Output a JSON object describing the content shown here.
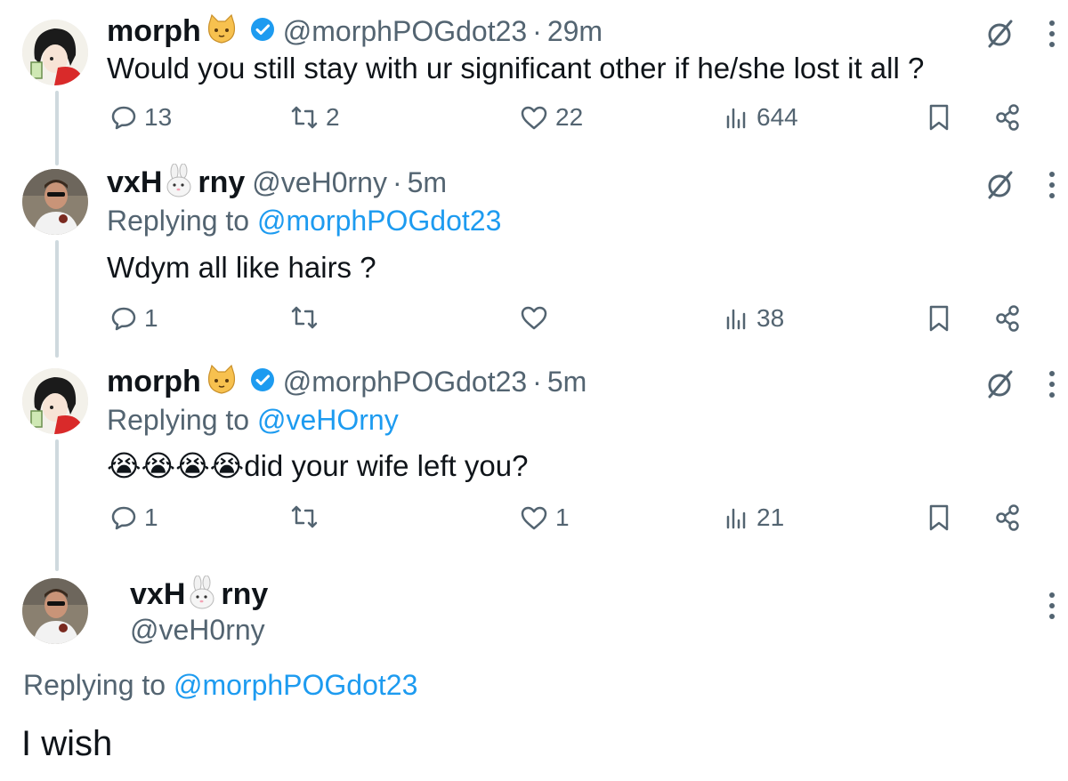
{
  "tweets": [
    {
      "name": "morph",
      "handle": "@morphPOGdot23",
      "time": "29m",
      "reply_prefix": "",
      "reply_to": "",
      "text": "Would you still stay with ur significant other if he/she lost it all ?",
      "replies": "13",
      "retweets": "2",
      "likes": "22",
      "views": "644"
    },
    {
      "name_a": "vxH",
      "name_b": "rny",
      "handle": "@veH0rny",
      "time": "5m",
      "reply_prefix": "Replying to",
      "reply_to": "@morphPOGdot23",
      "text": "Wdym all like hairs ?",
      "replies": "1",
      "retweets": "",
      "likes": "",
      "views": "38"
    },
    {
      "name": "morph",
      "handle": "@morphPOGdot23",
      "time": "5m",
      "reply_prefix": "Replying to",
      "reply_to": "@veHOrny",
      "emoji_prefix": "😭😭😭😭",
      "text": "did your wife left you?",
      "replies": "1",
      "retweets": "",
      "likes": "1",
      "views": "21"
    }
  ],
  "focused": {
    "name_a": "vxH",
    "name_b": "rny",
    "handle": "@veH0rny",
    "reply_prefix": "Replying to",
    "reply_to": "@morphPOGdot23",
    "text": "I wish"
  },
  "icons": {
    "verified": "verified-badge-icon",
    "cat": "cat-emoji-icon",
    "rabbit": "rabbit-emoji-icon",
    "grok": "grok-icon",
    "more": "more-vertical-icon",
    "reply": "reply-icon",
    "retweet": "retweet-icon",
    "like": "heart-icon",
    "views": "views-icon",
    "bookmark": "bookmark-icon",
    "share": "share-icon"
  },
  "colors": {
    "accent": "#1d9bf0",
    "muted": "#536471",
    "text": "#0f1419",
    "thread": "#cfd9de"
  }
}
